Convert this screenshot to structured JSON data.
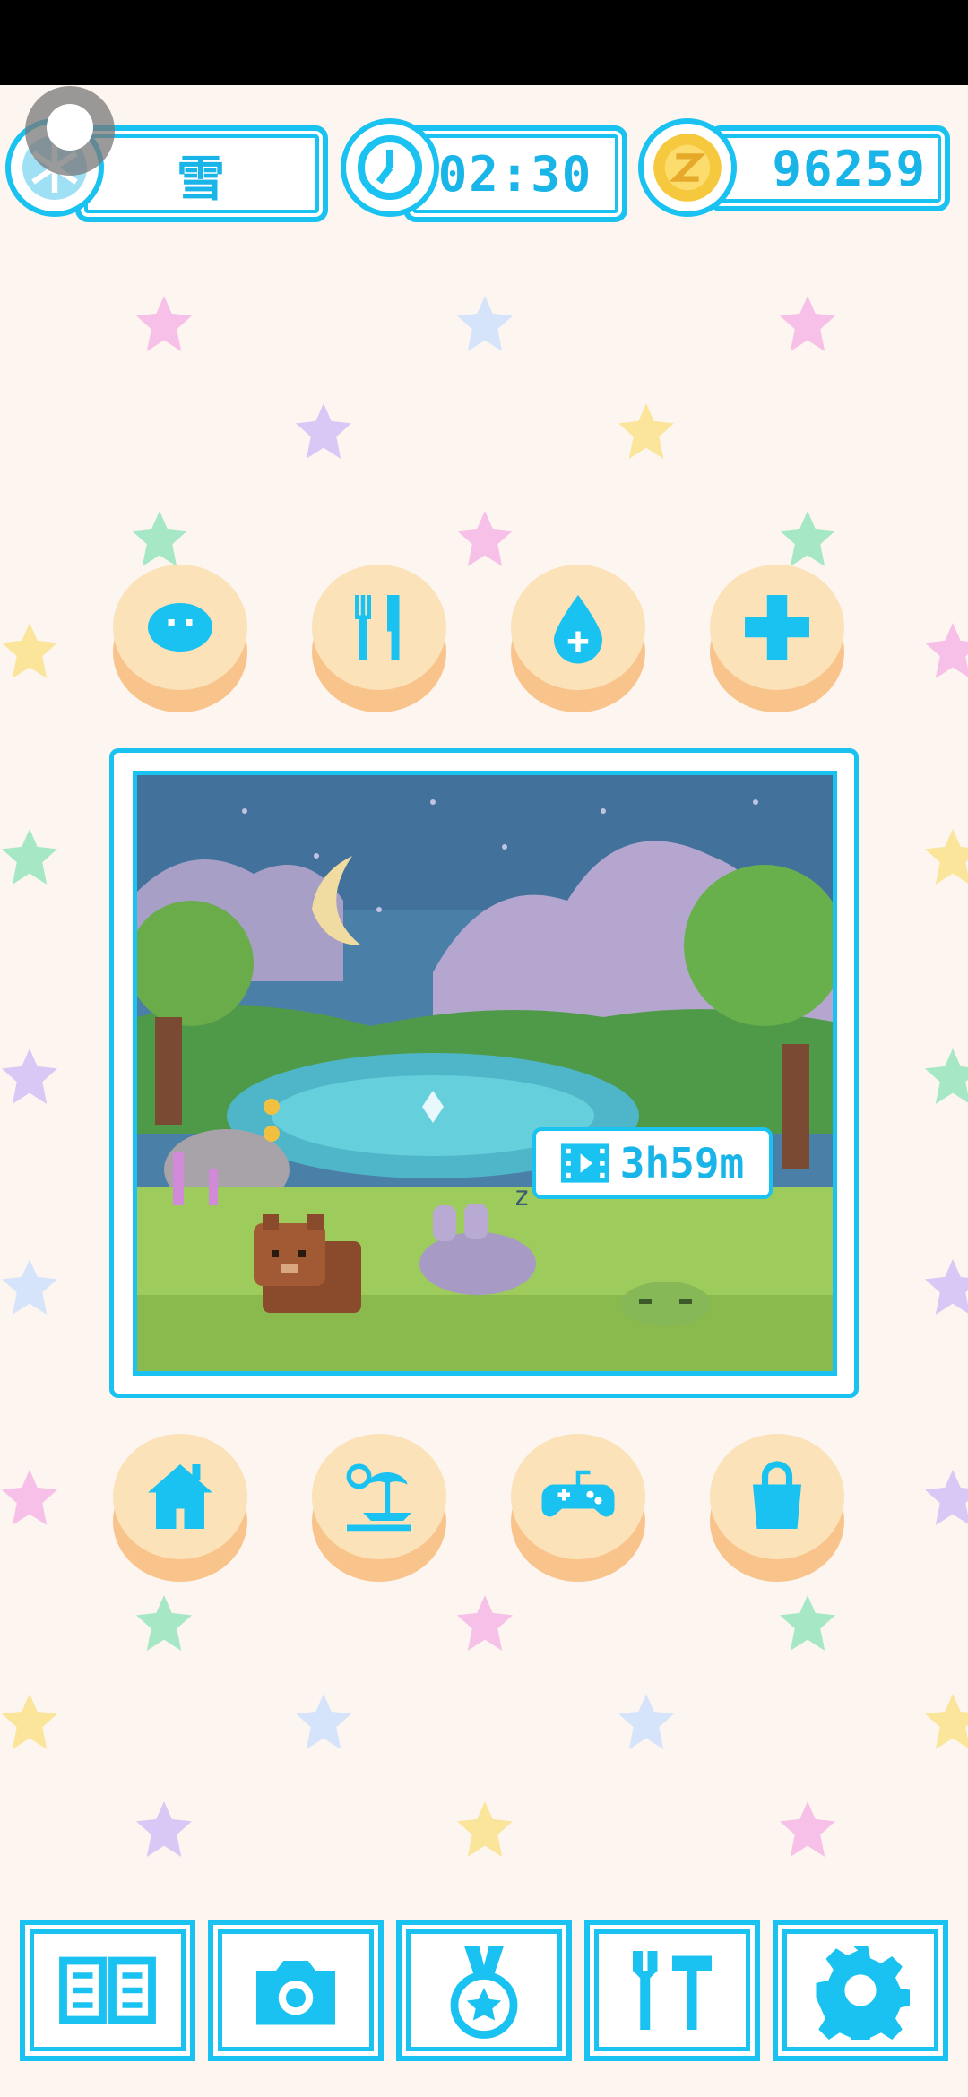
{
  "hud": {
    "weather_label": "雪",
    "time": "02:30",
    "coins": "96259"
  },
  "scene": {
    "timer_text": "3h59m",
    "sleep_mark": "z"
  },
  "icons": {
    "top_row": [
      "bubble-icon",
      "fork-knife-icon",
      "water-drop-icon",
      "plus-icon"
    ],
    "bottom_row": [
      "house-icon",
      "island-icon",
      "gamepad-icon",
      "bag-icon"
    ],
    "toolbar": [
      "book-icon",
      "camera-icon",
      "medal-icon",
      "tools-icon",
      "gear-icon"
    ]
  },
  "colors": {
    "accent": "#19c2f0",
    "button_face": "#fbe2b8",
    "button_side": "#f9c48c",
    "background": "#fdf5ef"
  }
}
